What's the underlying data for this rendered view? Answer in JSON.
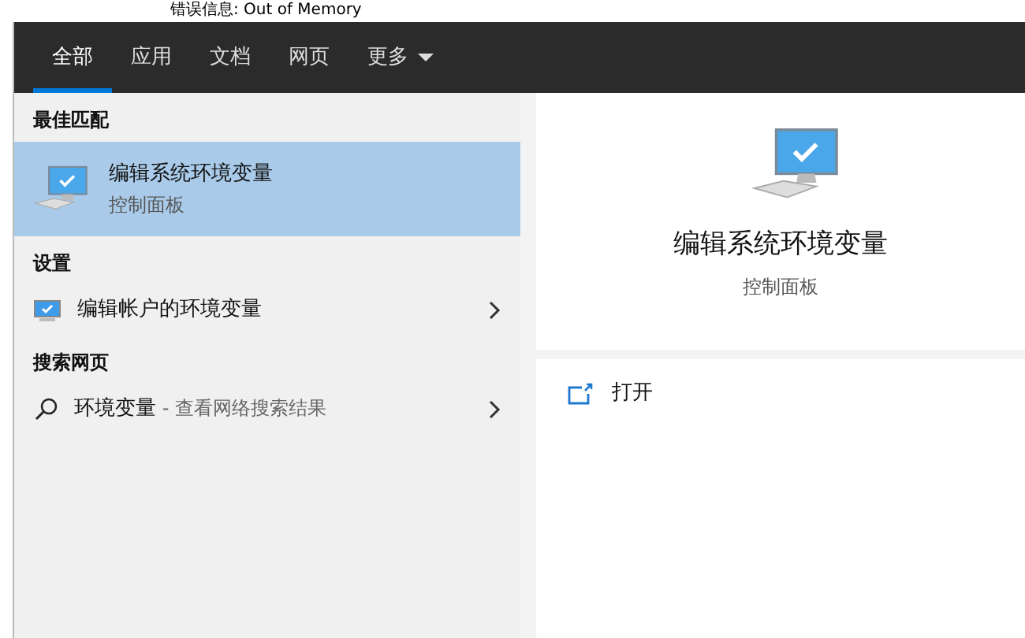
{
  "background_text": "错误信息: Out of Memory",
  "tabs": [
    {
      "label": "全部",
      "selected": true
    },
    {
      "label": "应用",
      "selected": false
    },
    {
      "label": "文档",
      "selected": false
    },
    {
      "label": "网页",
      "selected": false
    },
    {
      "label": "更多",
      "selected": false,
      "kind": "dropdown"
    }
  ],
  "sections": [
    {
      "heading": "最佳匹配",
      "items": [
        {
          "kind": "best",
          "title": "编辑系统环境变量",
          "subtitle": "控制面板",
          "selected": true
        }
      ]
    },
    {
      "heading": "设置",
      "items": [
        {
          "kind": "setting",
          "title": "编辑帐户的环境变量",
          "selected": false
        }
      ]
    },
    {
      "heading": "搜索网页",
      "items": [
        {
          "kind": "web",
          "title": "环境变量",
          "suffix": " - 查看网络搜索结果",
          "selected": false
        }
      ]
    }
  ],
  "preview": {
    "title": "编辑系统环境变量",
    "subtitle": "控制面板",
    "actions": [
      {
        "label": "打开"
      }
    ]
  }
}
